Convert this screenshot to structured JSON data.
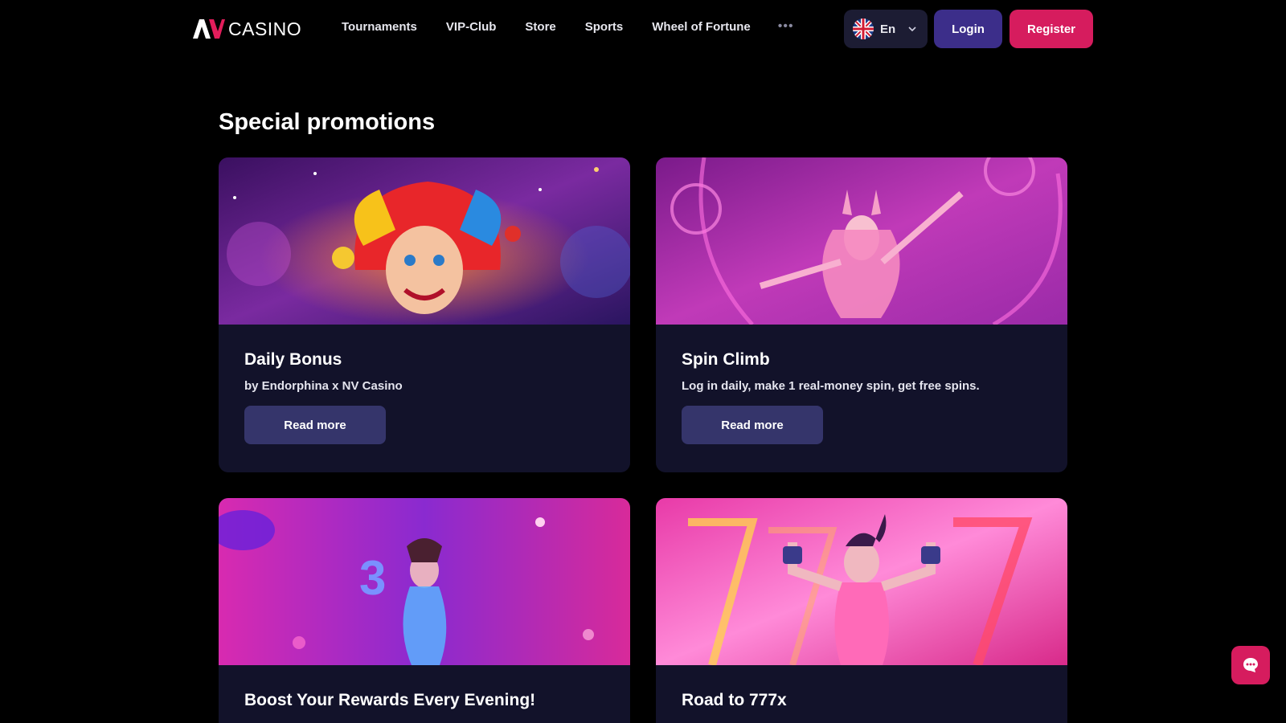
{
  "header": {
    "logo_text": "CASINO",
    "nav": [
      {
        "label": "Tournaments"
      },
      {
        "label": "VIP-Club"
      },
      {
        "label": "Store"
      },
      {
        "label": "Sports"
      },
      {
        "label": "Wheel of Fortune"
      }
    ],
    "more_label": "•••",
    "language": {
      "flag": "uk-flag-icon",
      "label": "En"
    },
    "login_label": "Login",
    "register_label": "Register"
  },
  "main": {
    "section_title": "Special promotions",
    "promotions": [
      {
        "title": "Daily Bonus",
        "description": "by Endorphina x NV Casino",
        "button": "Read more",
        "image": "jester-promo-image"
      },
      {
        "title": "Spin Climb",
        "description": "Log in daily, make 1 real-money spin, get free spins.",
        "button": "Read more",
        "image": "bunny-girl-promo-image"
      },
      {
        "title": "Boost Your Rewards Every Evening!",
        "image": "neon-dancer-promo-image"
      },
      {
        "title": "Road to 777x",
        "image": "fitness-girl-promo-image"
      }
    ]
  },
  "colors": {
    "background": "#000000",
    "card": "#12122a",
    "login": "#3c2e8a",
    "register": "#d61c5e",
    "read_more": "#35356b",
    "lang_bg": "#1c1c33"
  },
  "chat": {
    "icon": "chat-bubble-icon"
  }
}
